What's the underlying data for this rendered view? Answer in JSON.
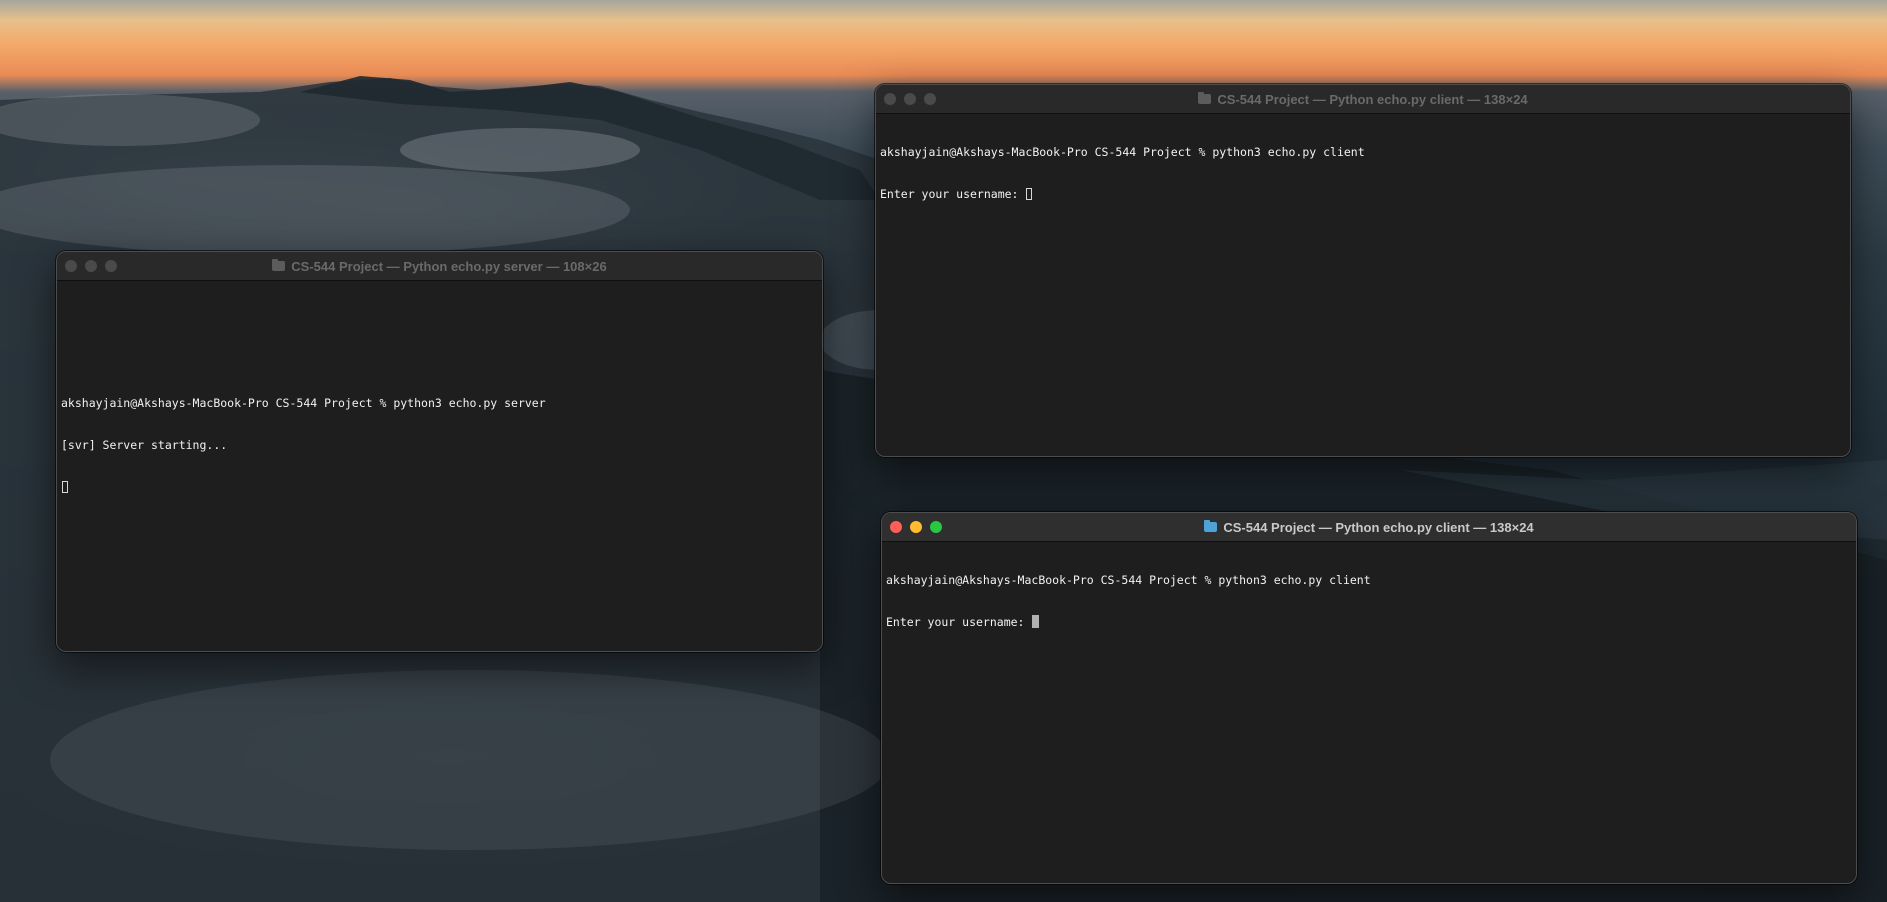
{
  "desktop": {
    "wallpaper": "sunset-mountains-clouds"
  },
  "windows": {
    "server": {
      "title": "CS-544 Project — Python echo.py server — 108×26",
      "active": false,
      "lines": [
        "",
        "",
        "akshayjain@Akshays-MacBook-Pro CS-544 Project % python3 echo.py server",
        "[svr] Server starting..."
      ],
      "cursor": "hollow"
    },
    "client_top": {
      "title": "CS-544 Project — Python echo.py client — 138×24",
      "active": false,
      "lines": [
        "akshayjain@Akshays-MacBook-Pro CS-544 Project % python3 echo.py client",
        "Enter your username: "
      ],
      "cursor": "hollow"
    },
    "client_bottom": {
      "title": "CS-544 Project — Python echo.py client — 138×24",
      "active": true,
      "lines": [
        "akshayjain@Akshays-MacBook-Pro CS-544 Project % python3 echo.py client",
        "Enter your username: "
      ],
      "cursor": "solid"
    }
  },
  "colors": {
    "close": "#ff5f57",
    "minimize": "#febc2e",
    "maximize": "#28c840",
    "terminal_bg": "#1e1e1e",
    "terminal_fg": "#f2f2f2"
  }
}
